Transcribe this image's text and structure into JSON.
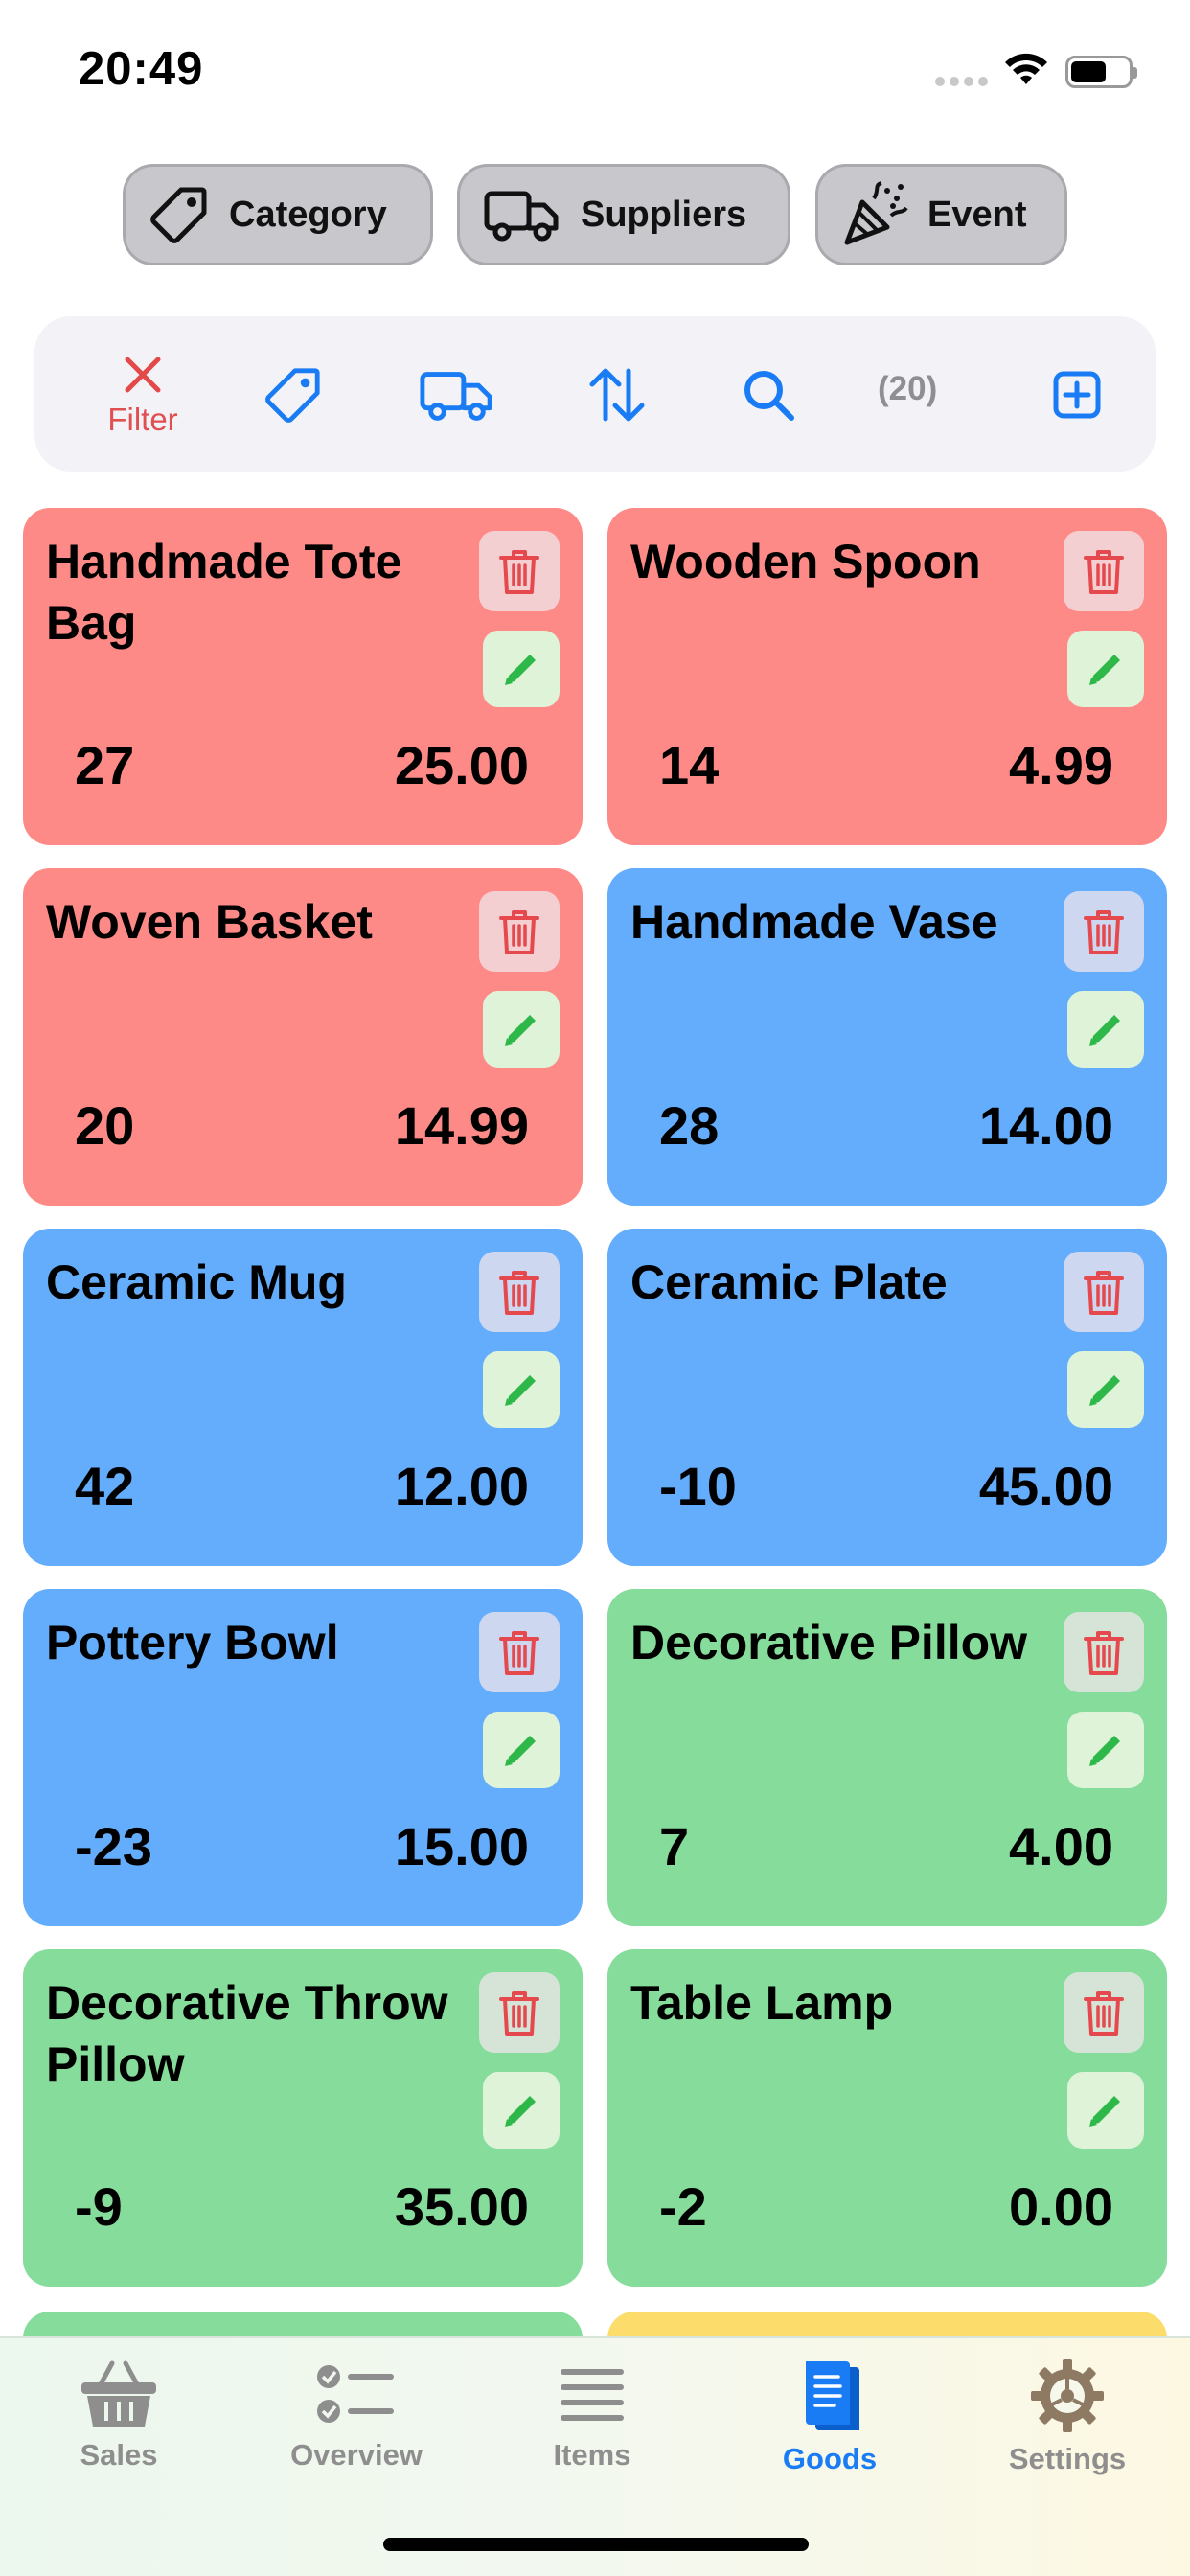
{
  "status": {
    "time": "20:49"
  },
  "chips": [
    {
      "label": "Category",
      "icon": "tag-icon"
    },
    {
      "label": "Suppliers",
      "icon": "truck-icon"
    },
    {
      "label": "Event",
      "icon": "party-popper-icon"
    }
  ],
  "toolbar": {
    "filter_label": "Filter",
    "count": "(20)"
  },
  "products": [
    {
      "name": "Handmade Tote Bag",
      "qty": "27",
      "price": "25.00",
      "color": "#fd8a86"
    },
    {
      "name": "Wooden Spoon",
      "qty": "14",
      "price": "4.99",
      "color": "#fd8a86"
    },
    {
      "name": "Woven Basket",
      "qty": "20",
      "price": "14.99",
      "color": "#fd8a86"
    },
    {
      "name": " Handmade Vase",
      "qty": "28",
      "price": "14.00",
      "color": "#64adfc"
    },
    {
      "name": "Ceramic Mug",
      "qty": "42",
      "price": "12.00",
      "color": "#64adfc"
    },
    {
      "name": "Ceramic Plate",
      "qty": "-10",
      "price": "45.00",
      "color": "#64adfc"
    },
    {
      "name": "Pottery Bowl",
      "qty": "-23",
      "price": "15.00",
      "color": "#64adfc"
    },
    {
      "name": "Decorative Pillow",
      "qty": "7",
      "price": "4.00",
      "color": "#86dd9b"
    },
    {
      "name": "Decorative Throw Pillow",
      "qty": "-9",
      "price": "35.00",
      "color": "#86dd9b"
    },
    {
      "name": "Table Lamp",
      "qty": "-2",
      "price": "0.00",
      "color": "#86dd9b"
    }
  ],
  "tabs": [
    {
      "label": "Sales",
      "icon": "basket-icon"
    },
    {
      "label": "Overview",
      "icon": "checklist-icon"
    },
    {
      "label": "Items",
      "icon": "menu-lines-icon"
    },
    {
      "label": "Goods",
      "icon": "document-icon",
      "active": true
    },
    {
      "label": "Settings",
      "icon": "gear-icon"
    }
  ]
}
